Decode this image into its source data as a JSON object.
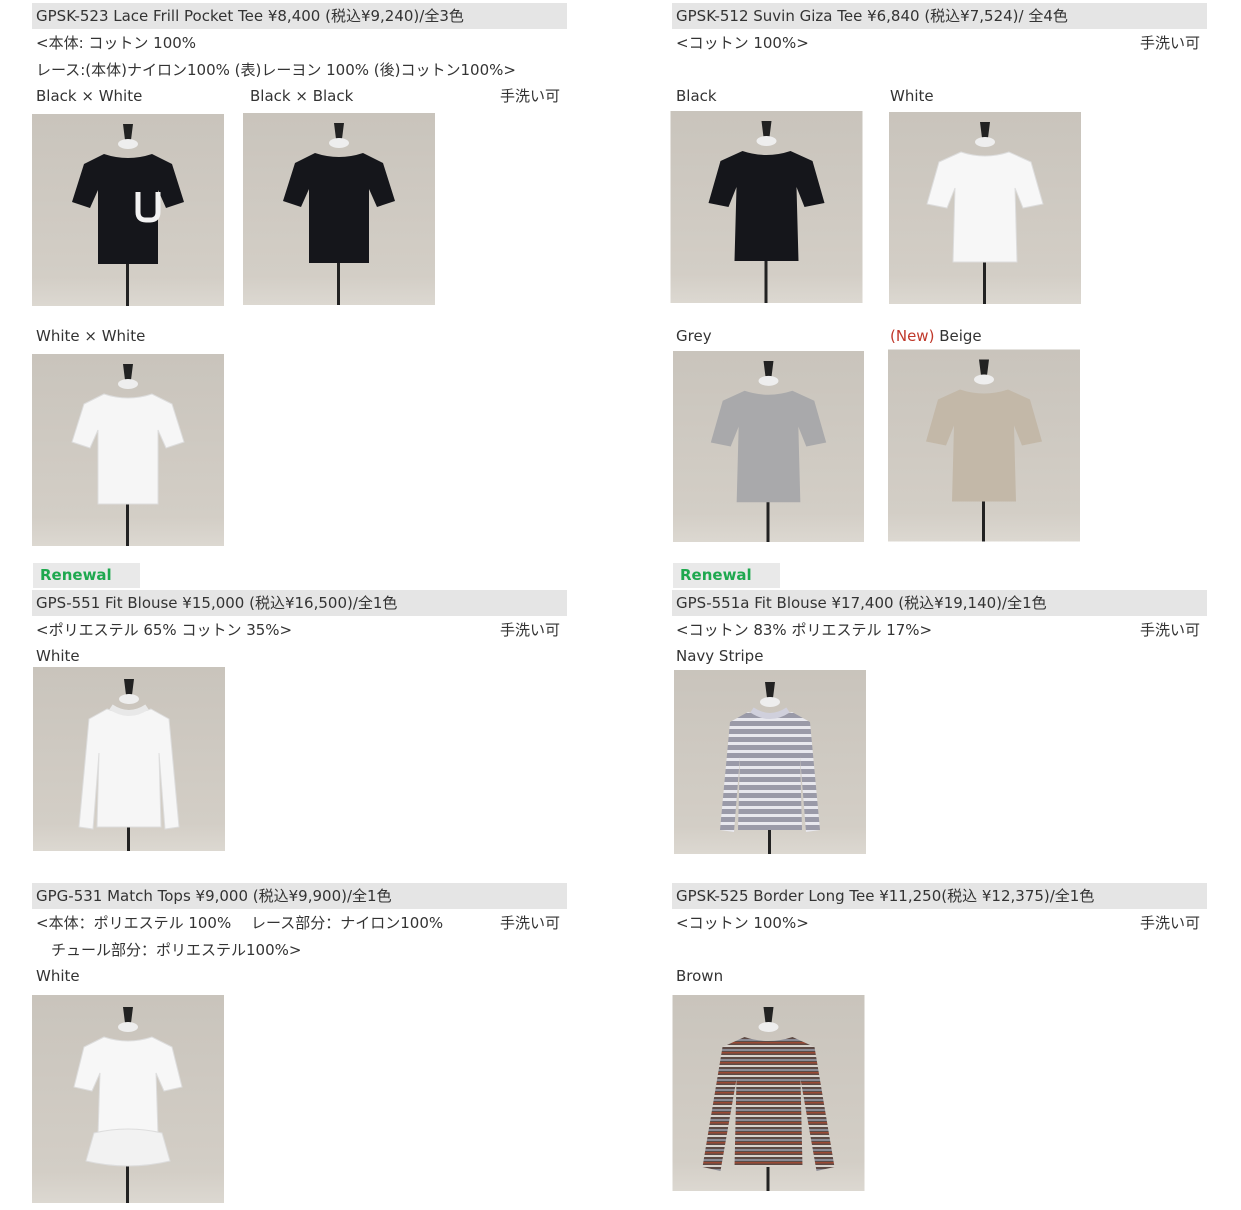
{
  "products": [
    {
      "id": "gpsk-523",
      "title": "GPSK-523 Lace Frill Pocket Tee ¥8,400 (税込¥9,240)/全3色",
      "material1": "<本体: コットン 100%",
      "material2": "レース:(本体)ナイロン100% (表)レーヨン 100% (後)コットン100%>",
      "care": "手洗い可",
      "colors": [
        "Black × White",
        "Black × Black",
        "White × White"
      ]
    },
    {
      "id": "gpsk-512",
      "title": "GPSK-512 Suvin Giza Tee ¥6,840 (税込¥7,524)/ 全4色",
      "material1": "<コットン 100%>",
      "care": "手洗い可",
      "colors": [
        "Black",
        "White",
        "Grey",
        "Beige"
      ],
      "new_tag": "(New)"
    },
    {
      "id": "gps-551",
      "badge": "Renewal",
      "title": "GPS-551  Fit Blouse ¥15,000 (税込¥16,500)/全1色",
      "material1": "<ポリエステル 65% コットン 35%>",
      "care": "手洗い可",
      "colors": [
        "White"
      ]
    },
    {
      "id": "gps-551a",
      "badge": "Renewal",
      "title": "GPS-551a  Fit Blouse ¥17,400 (税込¥19,140)/全1色",
      "material1": "<コットン 83% ポリエステル 17%>",
      "care": "手洗い可",
      "colors": [
        "Navy Stripe"
      ]
    },
    {
      "id": "gpg-531",
      "title": "GPG-531 Match Tops ¥9,000 (税込¥9,900)/全1色",
      "material1": "<本体：ポリエステル 100%　 レース部分：ナイロン100%",
      "material2": "　チュール部分：ポリエステル100%>",
      "care": "手洗い可",
      "colors": [
        "White"
      ]
    },
    {
      "id": "gpsk-525",
      "title": "GPSK-525 Border Long Tee ¥11,250(税込 ¥12,375)/全1色",
      "material1": "<コットン 100%>",
      "care": "手洗い可",
      "colors": [
        "Brown"
      ]
    }
  ],
  "photo_colors": {
    "backdrop": "#cfcac2",
    "floor": "#d8d3cb",
    "stand": "#222222"
  }
}
